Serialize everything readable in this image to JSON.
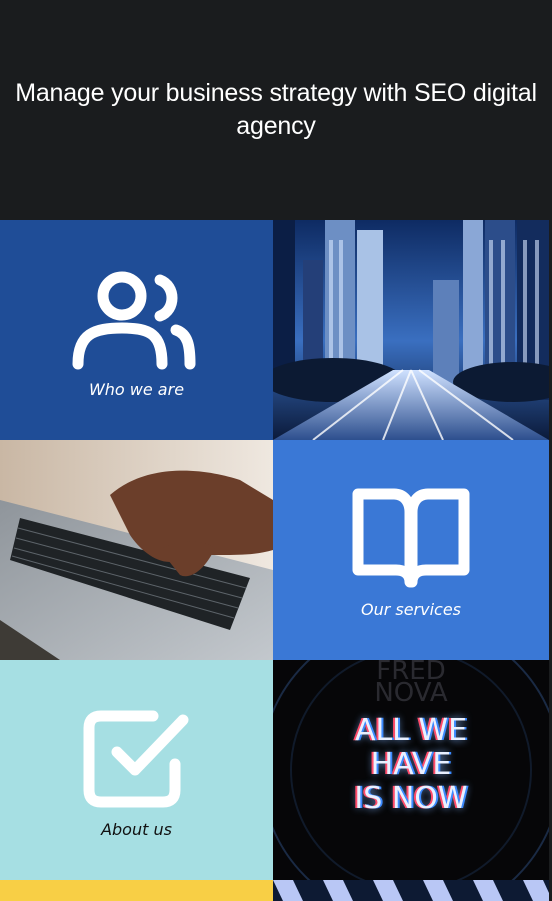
{
  "hero": {
    "title": "Manage your business strategy with SEO digital agency"
  },
  "tiles": {
    "who": {
      "label": "Who we are",
      "bg": "#1f4d97",
      "icon": "users-icon"
    },
    "city": {
      "icon": "city-photo"
    },
    "laptop": {
      "icon": "laptop-typing-photo"
    },
    "services": {
      "label": "Our services",
      "bg": "#3a78d6",
      "icon": "book-icon"
    },
    "about": {
      "label": "About us",
      "bg": "#a6dfe3",
      "icon": "checkbox-icon"
    },
    "neon": {
      "lines": [
        "ALL WE",
        "HAVE",
        "IS NOW"
      ],
      "watermark": [
        "FRED",
        "NOVA"
      ]
    }
  },
  "colors": {
    "accent_yellow": "#f8cf45",
    "hero_bg": "#1a1c1e"
  }
}
